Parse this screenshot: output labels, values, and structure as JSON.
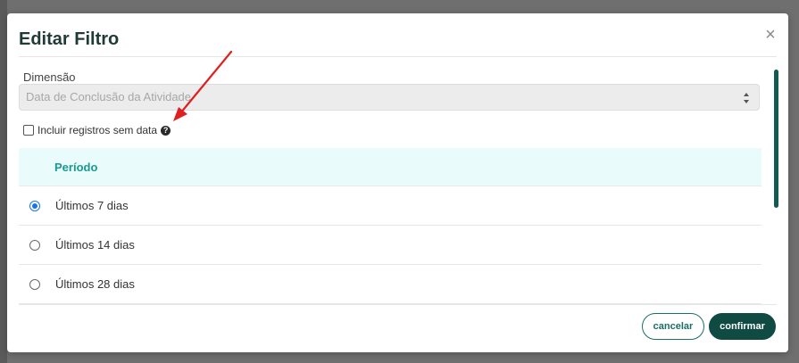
{
  "modal": {
    "title": "Editar Filtro",
    "close_symbol": "×"
  },
  "dimension": {
    "label": "Dimensão",
    "selected_value": "Data de Conclusão da Atividade"
  },
  "include_without_date": {
    "label": "Incluir registros sem data",
    "checked": false,
    "help_symbol": "?"
  },
  "period_table": {
    "header": "Período",
    "options": [
      {
        "label": "Últimos 7 dias",
        "selected": true
      },
      {
        "label": "Últimos 14 dias",
        "selected": false
      },
      {
        "label": "Últimos 28 dias",
        "selected": false
      }
    ]
  },
  "footer": {
    "cancel_label": "cancelar",
    "confirm_label": "confirmar"
  },
  "colors": {
    "accent": "#0f4a43",
    "header_bg": "#e9fbfa",
    "header_text": "#1a9a8f",
    "annotation_arrow": "#e02020"
  },
  "icons": {
    "close": "close-icon",
    "select": "chevron-updown-icon",
    "help": "question-circle-icon",
    "annotation": "red-arrow-annotation"
  }
}
